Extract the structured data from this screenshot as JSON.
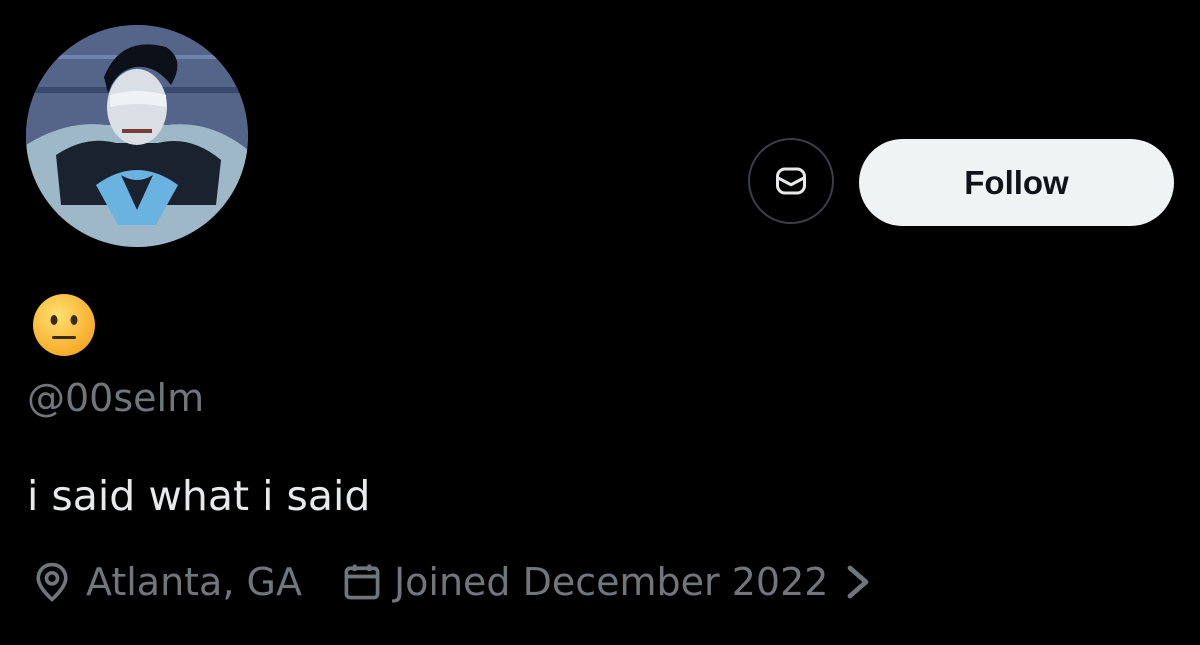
{
  "profile": {
    "avatar_alt": "profile picture",
    "display_name_emoji": "neutral-face-emoji",
    "handle": "@00selm",
    "bio": "i said what i said",
    "location": "Atlanta, GA",
    "joined": "Joined December 2022"
  },
  "actions": {
    "message_icon": "envelope-icon",
    "follow_label": "Follow"
  },
  "icons": {
    "location": "location-pin-icon",
    "calendar": "calendar-icon",
    "more": "chevron-right-icon"
  },
  "colors": {
    "background": "#000000",
    "primary_text": "#e7e9ea",
    "secondary_text": "#71767b",
    "follow_bg": "#eff3f4",
    "follow_text": "#0f1419",
    "border": "#3a3f44"
  }
}
